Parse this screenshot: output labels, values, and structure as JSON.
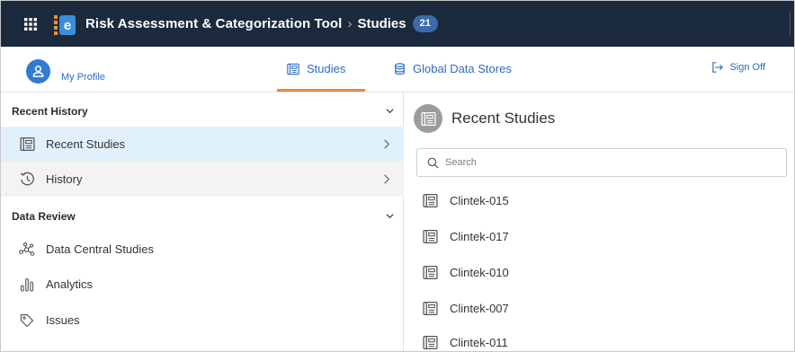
{
  "header": {
    "app_title": "Risk Assessment & Categorization Tool",
    "separator": "›",
    "breadcrumb": "Studies",
    "count": "21"
  },
  "nav": {
    "profile_label": "My Profile",
    "tabs": [
      {
        "label": "Studies",
        "active": true
      },
      {
        "label": "Global Data Stores",
        "active": false
      }
    ],
    "signoff_label": "Sign Off"
  },
  "sidebar": {
    "sections": [
      {
        "title": "Recent History",
        "items": [
          {
            "label": "Recent Studies",
            "icon": "studies-icon",
            "selected": true
          },
          {
            "label": "History",
            "icon": "history-icon",
            "selected": false
          }
        ]
      },
      {
        "title": "Data Review",
        "items": [
          {
            "label": "Data Central Studies",
            "icon": "network-icon"
          },
          {
            "label": "Analytics",
            "icon": "analytics-icon"
          },
          {
            "label": "Issues",
            "icon": "tag-icon"
          }
        ]
      }
    ]
  },
  "panel": {
    "title": "Recent Studies",
    "search_placeholder": "Search",
    "studies": [
      "Clintek-015",
      "Clintek-017",
      "Clintek-010",
      "Clintek-007",
      "Clintek-011"
    ]
  },
  "colors": {
    "header_bg": "#1c2a3d",
    "accent_blue": "#2a6cc4",
    "tab_underline": "#e38a3f",
    "selected_bg": "#e1f1fb",
    "badge_bg": "#3d6aa8"
  }
}
